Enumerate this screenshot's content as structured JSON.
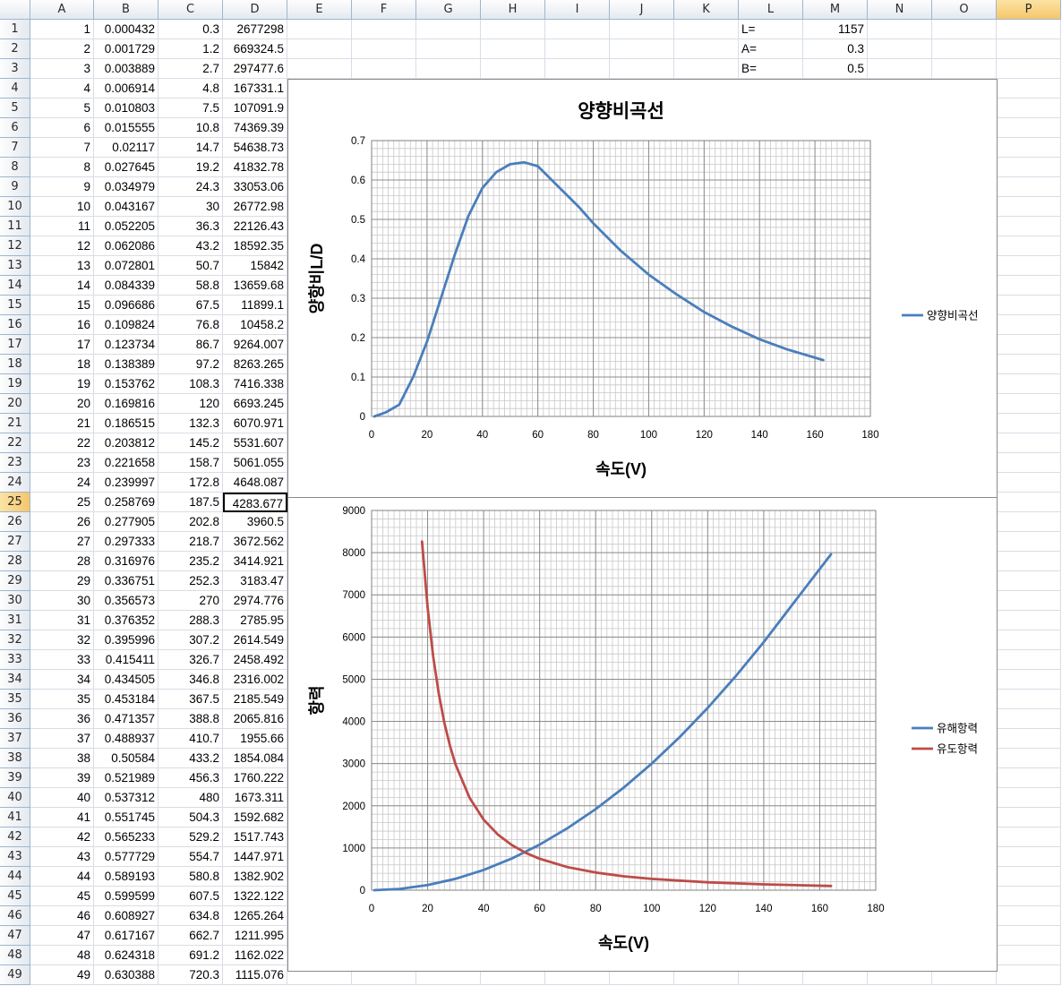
{
  "columns": [
    "A",
    "B",
    "C",
    "D",
    "E",
    "F",
    "G",
    "H",
    "I",
    "J",
    "K",
    "L",
    "M",
    "N",
    "O",
    "P"
  ],
  "selected_column": "P",
  "selected_row": 25,
  "active_cell": "D25",
  "rows": [
    [
      "1",
      "0.000432",
      "0.3",
      "2677298"
    ],
    [
      "2",
      "0.001729",
      "1.2",
      "669324.5"
    ],
    [
      "3",
      "0.003889",
      "2.7",
      "297477.6"
    ],
    [
      "4",
      "0.006914",
      "4.8",
      "167331.1"
    ],
    [
      "5",
      "0.010803",
      "7.5",
      "107091.9"
    ],
    [
      "6",
      "0.015555",
      "10.8",
      "74369.39"
    ],
    [
      "7",
      "0.02117",
      "14.7",
      "54638.73"
    ],
    [
      "8",
      "0.027645",
      "19.2",
      "41832.78"
    ],
    [
      "9",
      "0.034979",
      "24.3",
      "33053.06"
    ],
    [
      "10",
      "0.043167",
      "30",
      "26772.98"
    ],
    [
      "11",
      "0.052205",
      "36.3",
      "22126.43"
    ],
    [
      "12",
      "0.062086",
      "43.2",
      "18592.35"
    ],
    [
      "13",
      "0.072801",
      "50.7",
      "15842"
    ],
    [
      "14",
      "0.084339",
      "58.8",
      "13659.68"
    ],
    [
      "15",
      "0.096686",
      "67.5",
      "11899.1"
    ],
    [
      "16",
      "0.109824",
      "76.8",
      "10458.2"
    ],
    [
      "17",
      "0.123734",
      "86.7",
      "9264.007"
    ],
    [
      "18",
      "0.138389",
      "97.2",
      "8263.265"
    ],
    [
      "19",
      "0.153762",
      "108.3",
      "7416.338"
    ],
    [
      "20",
      "0.169816",
      "120",
      "6693.245"
    ],
    [
      "21",
      "0.186515",
      "132.3",
      "6070.971"
    ],
    [
      "22",
      "0.203812",
      "145.2",
      "5531.607"
    ],
    [
      "23",
      "0.221658",
      "158.7",
      "5061.055"
    ],
    [
      "24",
      "0.239997",
      "172.8",
      "4648.087"
    ],
    [
      "25",
      "0.258769",
      "187.5",
      "4283.677"
    ],
    [
      "26",
      "0.277905",
      "202.8",
      "3960.5"
    ],
    [
      "27",
      "0.297333",
      "218.7",
      "3672.562"
    ],
    [
      "28",
      "0.316976",
      "235.2",
      "3414.921"
    ],
    [
      "29",
      "0.336751",
      "252.3",
      "3183.47"
    ],
    [
      "30",
      "0.356573",
      "270",
      "2974.776"
    ],
    [
      "31",
      "0.376352",
      "288.3",
      "2785.95"
    ],
    [
      "32",
      "0.395996",
      "307.2",
      "2614.549"
    ],
    [
      "33",
      "0.415411",
      "326.7",
      "2458.492"
    ],
    [
      "34",
      "0.434505",
      "346.8",
      "2316.002"
    ],
    [
      "35",
      "0.453184",
      "367.5",
      "2185.549"
    ],
    [
      "36",
      "0.471357",
      "388.8",
      "2065.816"
    ],
    [
      "37",
      "0.488937",
      "410.7",
      "1955.66"
    ],
    [
      "38",
      "0.50584",
      "433.2",
      "1854.084"
    ],
    [
      "39",
      "0.521989",
      "456.3",
      "1760.222"
    ],
    [
      "40",
      "0.537312",
      "480",
      "1673.311"
    ],
    [
      "41",
      "0.551745",
      "504.3",
      "1592.682"
    ],
    [
      "42",
      "0.565233",
      "529.2",
      "1517.743"
    ],
    [
      "43",
      "0.577729",
      "554.7",
      "1447.971"
    ],
    [
      "44",
      "0.589193",
      "580.8",
      "1382.902"
    ],
    [
      "45",
      "0.599599",
      "607.5",
      "1322.122"
    ],
    [
      "46",
      "0.608927",
      "634.8",
      "1265.264"
    ],
    [
      "47",
      "0.617167",
      "662.7",
      "1211.995"
    ],
    [
      "48",
      "0.624318",
      "691.2",
      "1162.022"
    ],
    [
      "49",
      "0.630388",
      "720.3",
      "1115.076"
    ]
  ],
  "params": [
    {
      "label": "L=",
      "value": "1157"
    },
    {
      "label": "A=",
      "value": "0.3"
    },
    {
      "label": "B=",
      "value": "0.5"
    }
  ],
  "chart_data": [
    {
      "type": "line",
      "title": "양향비곡선",
      "xlabel": "속도(V)",
      "ylabel": "양항비L/D",
      "xlim": [
        0,
        180
      ],
      "ylim": [
        0,
        0.7
      ],
      "xticks": [
        "0",
        "20",
        "40",
        "60",
        "80",
        "100",
        "120",
        "140",
        "160",
        "180"
      ],
      "yticks": [
        "0",
        "0.1",
        "0.2",
        "0.3",
        "0.4",
        "0.5",
        "0.6",
        "0.7"
      ],
      "grid": true,
      "legend_position": "right",
      "series": [
        {
          "name": "양향비곡선",
          "color": "#4a7ebb",
          "x": [
            1,
            5,
            10,
            15,
            20,
            25,
            30,
            35,
            40,
            45,
            50,
            55,
            60,
            65,
            70,
            75,
            80,
            90,
            100,
            110,
            120,
            130,
            140,
            150,
            163
          ],
          "y": [
            0.0,
            0.01,
            0.03,
            0.1,
            0.19,
            0.3,
            0.41,
            0.51,
            0.58,
            0.62,
            0.64,
            0.645,
            0.635,
            0.6,
            0.565,
            0.53,
            0.49,
            0.42,
            0.36,
            0.31,
            0.265,
            0.228,
            0.196,
            0.17,
            0.143
          ]
        }
      ]
    },
    {
      "type": "line",
      "title": "",
      "xlabel": "속도(V)",
      "ylabel": "항력",
      "xlim": [
        0,
        180
      ],
      "ylim": [
        0,
        9000
      ],
      "xticks": [
        "0",
        "20",
        "40",
        "60",
        "80",
        "100",
        "120",
        "140",
        "160",
        "180"
      ],
      "yticks": [
        "0",
        "1000",
        "2000",
        "3000",
        "4000",
        "5000",
        "6000",
        "7000",
        "8000",
        "9000"
      ],
      "grid": true,
      "legend_position": "right",
      "series": [
        {
          "name": "유해항력",
          "color": "#4a7ebb",
          "x": [
            1,
            10,
            20,
            30,
            40,
            50,
            60,
            70,
            80,
            90,
            100,
            110,
            120,
            130,
            140,
            150,
            164
          ],
          "y": [
            0,
            30,
            120,
            270,
            480,
            750,
            1080,
            1470,
            1920,
            2430,
            3000,
            3630,
            4320,
            5070,
            5880,
            6750,
            7960
          ]
        },
        {
          "name": "유도항력",
          "color": "#be4b48",
          "x": [
            18,
            20,
            22,
            24,
            26,
            28,
            30,
            35,
            40,
            45,
            50,
            55,
            60,
            70,
            80,
            90,
            100,
            120,
            140,
            164
          ],
          "y": [
            8263,
            6693,
            5532,
            4648,
            3961,
            3415,
            2975,
            2186,
            1673,
            1322,
            1071,
            885,
            744,
            546,
            418,
            330,
            268,
            186,
            137,
            100
          ]
        }
      ]
    }
  ]
}
